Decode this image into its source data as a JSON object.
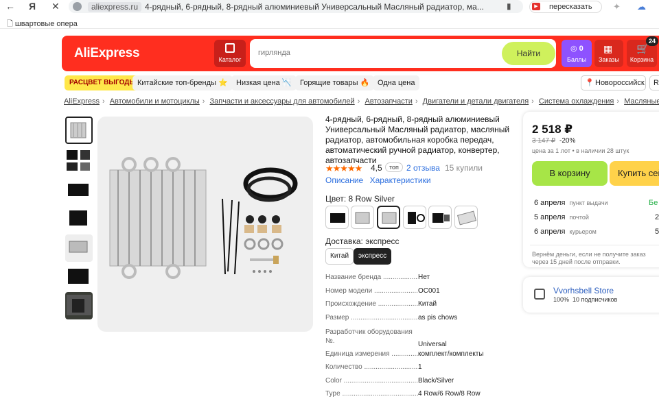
{
  "browser": {
    "url": "aliexpress.ru",
    "title": "4-рядный, 6-рядный, 8-рядный алюминиевый Универсальный Масляный радиатор, ма...",
    "translate_label": "пересказать",
    "bookmark": "швартовые опера"
  },
  "header": {
    "logo": "AliExpress",
    "catalog": "Каталог",
    "search_placeholder": "гирлянда",
    "search_button": "Найти",
    "points_count": "0",
    "points_label": "Баллы",
    "orders_label": "Заказы",
    "cart_label": "Корзина",
    "cart_count": "24"
  },
  "chips": [
    "РАСЦВЕТ ВЫГОДЫ",
    "Китайские топ-бренды ⭐",
    "Низкая цена 📉",
    "Горящие товары 🔥",
    "Одна цена"
  ],
  "city": "Новороссийск",
  "city2": "R",
  "breadcrumbs": [
    "AliExpress",
    "Автомобили и мотоциклы",
    "Запчасти и аксессуары для автомобилей",
    "Автозапчасти",
    "Двигатели и детали двигателя",
    "Система охлаждения",
    "Масляные радиаторы"
  ],
  "product": {
    "title": "4-рядный, 6-рядный, 8-рядный алюминиевый Универсальный Масляный радиатор, масляный радиатор, автомобильная коробка передач, автоматический ручной радиатор, конвертер, автозапчасти",
    "stars": "★★★★★",
    "rating": "4,5",
    "top_badge": "топ",
    "reviews": "2 отзыва",
    "bought": "15 купили",
    "link_desc": "Описание",
    "link_specs": "Характеристики",
    "color_label": "Цвет: 8 Row Silver",
    "delivery_label": "Доставка: экспресс",
    "delivery_options": [
      "Китай",
      "экспресс"
    ],
    "specs": [
      {
        "k": "Название бренда",
        "v": "Нет"
      },
      {
        "k": "Номер модели",
        "v": "OC001"
      },
      {
        "k": "Происхождение",
        "v": "Китай"
      },
      {
        "k": "Размер",
        "v": "as pis chows"
      },
      {
        "k": "Разработчик оборудования №.",
        "v": "Universal"
      },
      {
        "k": "Единица измерения",
        "v": "комплект/комплекты"
      },
      {
        "k": "Количество",
        "v": "1"
      },
      {
        "k": "Color",
        "v": "Black/Silver"
      },
      {
        "k": "Type",
        "v": "4 Row/6 Row/8 Row"
      }
    ]
  },
  "buy": {
    "price": "2 518 ₽",
    "old_price": "3 147 ₽",
    "discount": "-20%",
    "lot": "цена за 1 лот • в наличии 28 штук",
    "cart_button": "В корзину",
    "buy_button": "Купить сейчас",
    "delivery": [
      {
        "date": "6 апреля",
        "method": "пункт выдачи",
        "right": "Бе"
      },
      {
        "date": "5 апреля",
        "method": "почтой",
        "right": "2"
      },
      {
        "date": "6 апреля",
        "method": "курьером",
        "right": "5"
      }
    ],
    "refund": "Вернём деньги, если не получите заказ через 15 дней после отправки."
  },
  "store": {
    "name": "Vvorhsbell Store",
    "rating": "100%",
    "subs": "10 подписчиков"
  },
  "colors": {
    "accent": "#ff2e1f",
    "search_btn": "#cff15c",
    "points": "#8e52ff",
    "cart_btn": "#a7e547",
    "buy_btn": "#ffd24a",
    "link": "#2d6fdf"
  }
}
